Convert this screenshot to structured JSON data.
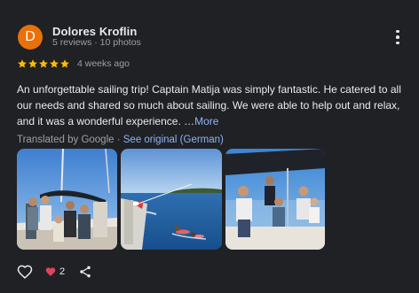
{
  "reviewer": {
    "initial": "D",
    "name": "Dolores Kroflin",
    "meta": "5 reviews · 10 photos",
    "avatar_color": "#e8710a"
  },
  "rating": {
    "stars": 5,
    "time": "4 weeks ago",
    "star_color": "#fbbc04"
  },
  "review": {
    "text": "An unforgettable sailing trip! Captain Matija was simply fantastic. He catered to all our needs and shared so much about sailing. We were able to help out and relax, and it was a wonderful experience. …",
    "more_label": "More"
  },
  "translation": {
    "label": "Translated by Google · ",
    "see_original": "See original (German)"
  },
  "photos": [
    {
      "name": "group-on-sailboat-photo"
    },
    {
      "name": "swimmers-at-sea-photo"
    },
    {
      "name": "group-in-cockpit-photo"
    }
  ],
  "actions": {
    "like_icon": "heart-outline-icon",
    "likes_icon": "heart-filled-icon",
    "likes_count": "2",
    "share_icon": "share-icon",
    "likes_color": "#f28b82"
  }
}
